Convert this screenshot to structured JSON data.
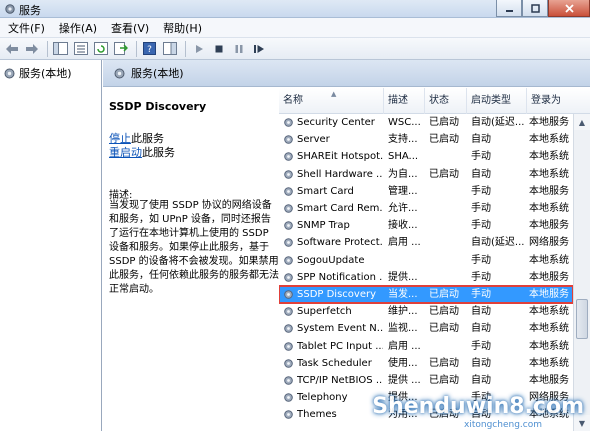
{
  "window": {
    "title": "服务"
  },
  "menu": [
    "文件(F)",
    "操作(A)",
    "查看(V)",
    "帮助(H)"
  ],
  "tree": {
    "root": "服务(本地)"
  },
  "panel": {
    "header": "服务(本地)"
  },
  "detail": {
    "service_name": "SSDP Discovery",
    "stop_link": "停止",
    "stop_suffix": "此服务",
    "restart_link": "重启动",
    "restart_suffix": "此服务",
    "desc_label": "描述:",
    "description": "当发现了使用 SSDP 协议的网络设备和服务，如 UPnP 设备，同时还报告了运行在本地计算机上使用的 SSDP 设备和服务。如果停止此服务，基于 SSDP 的设备将不会被发现。如果禁用此服务，任何依赖此服务的服务都无法正常启动。"
  },
  "list": {
    "columns": {
      "name": "名称",
      "desc": "描述",
      "state": "状态",
      "start": "启动类型",
      "logon": "登录为"
    },
    "rows": [
      {
        "name": "Security Center",
        "desc": "WSC...",
        "state": "已启动",
        "start": "自动(延迟...",
        "logon": "本地服务"
      },
      {
        "name": "Server",
        "desc": "支持...",
        "state": "已启动",
        "start": "自动",
        "logon": "本地系统"
      },
      {
        "name": "SHAREit Hotspot...",
        "desc": "SHA...",
        "state": "",
        "start": "手动",
        "logon": "本地系统"
      },
      {
        "name": "Shell Hardware ...",
        "desc": "为自...",
        "state": "已启动",
        "start": "自动",
        "logon": "本地系统"
      },
      {
        "name": "Smart Card",
        "desc": "管理...",
        "state": "",
        "start": "手动",
        "logon": "本地服务"
      },
      {
        "name": "Smart Card Rem...",
        "desc": "允许...",
        "state": "",
        "start": "手动",
        "logon": "本地系统"
      },
      {
        "name": "SNMP Trap",
        "desc": "接收...",
        "state": "",
        "start": "手动",
        "logon": "本地服务"
      },
      {
        "name": "Software Protect...",
        "desc": "启用 ...",
        "state": "",
        "start": "自动(延迟...",
        "logon": "网络服务"
      },
      {
        "name": "SogouUpdate",
        "desc": "",
        "state": "",
        "start": "手动",
        "logon": "本地系统"
      },
      {
        "name": "SPP Notification ...",
        "desc": "提供...",
        "state": "",
        "start": "手动",
        "logon": "本地服务"
      },
      {
        "name": "SSDP Discovery",
        "desc": "当发...",
        "state": "已启动",
        "start": "手动",
        "logon": "本地服务",
        "selected": true
      },
      {
        "name": "Superfetch",
        "desc": "维护...",
        "state": "已启动",
        "start": "自动",
        "logon": "本地系统"
      },
      {
        "name": "System Event N...",
        "desc": "监视...",
        "state": "已启动",
        "start": "自动",
        "logon": "本地系统"
      },
      {
        "name": "Tablet PC Input ...",
        "desc": "启用 ...",
        "state": "",
        "start": "手动",
        "logon": "本地系统"
      },
      {
        "name": "Task Scheduler",
        "desc": "使用...",
        "state": "已启动",
        "start": "自动",
        "logon": "本地系统"
      },
      {
        "name": "TCP/IP NetBIOS ...",
        "desc": "提供 ...",
        "state": "已启动",
        "start": "自动",
        "logon": "本地服务"
      },
      {
        "name": "Telephony",
        "desc": "提供...",
        "state": "",
        "start": "手动",
        "logon": "网络服务"
      },
      {
        "name": "Themes",
        "desc": "为用...",
        "state": "已启动",
        "start": "自动",
        "logon": "本地系统"
      }
    ]
  },
  "watermark": {
    "main": "Shenduwin8.com",
    "sub": "xitongcheng.com"
  },
  "colors": {
    "selection": "#3399ff",
    "highlight_border": "#e0403a",
    "link": "#0b53b8"
  }
}
